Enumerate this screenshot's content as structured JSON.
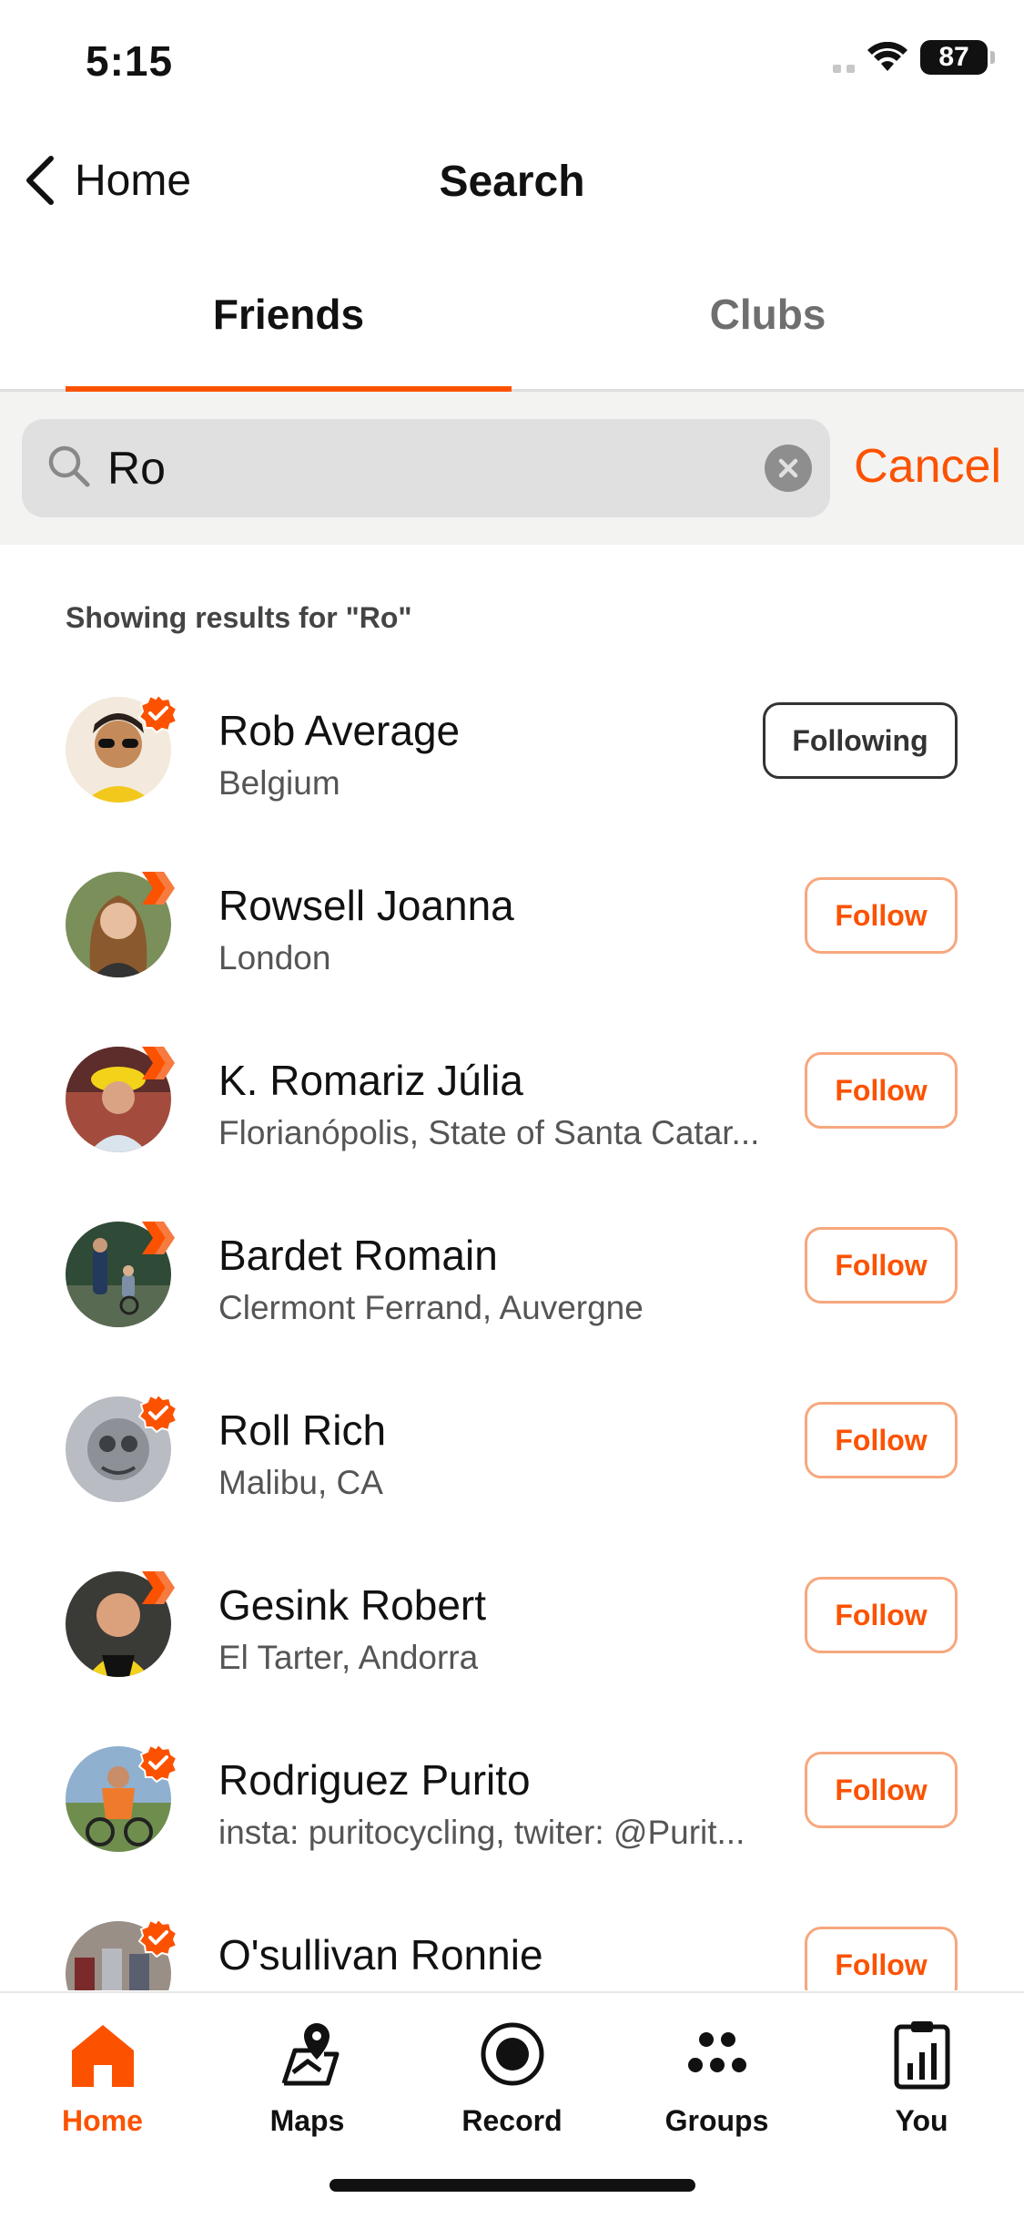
{
  "status_bar": {
    "time": "5:15",
    "battery": "87"
  },
  "nav": {
    "back_label": "Home",
    "title": "Search"
  },
  "tabs": [
    {
      "label": "Friends",
      "active": true
    },
    {
      "label": "Clubs",
      "active": false
    }
  ],
  "search": {
    "value": "Ro",
    "placeholder": "",
    "cancel_label": "Cancel"
  },
  "results_label": "Showing results for \"Ro\"",
  "results": [
    {
      "name": "Rob Average",
      "location": "Belgium",
      "button": "Following",
      "badge": "verified-badge-icon"
    },
    {
      "name": "Rowsell Joanna",
      "location": "London",
      "button": "Follow",
      "badge": "subscriber-chevron-icon"
    },
    {
      "name": "K. Romariz Júlia",
      "location": "Florianópolis, State of Santa Catar...",
      "button": "Follow",
      "badge": "subscriber-chevron-icon"
    },
    {
      "name": "Bardet Romain",
      "location": "Clermont Ferrand, Auvergne",
      "button": "Follow",
      "badge": "subscriber-chevron-icon"
    },
    {
      "name": "Roll Rich",
      "location": "Malibu, CA",
      "button": "Follow",
      "badge": "verified-badge-icon"
    },
    {
      "name": "Gesink Robert",
      "location": "El Tarter, Andorra",
      "button": "Follow",
      "badge": "subscriber-chevron-icon"
    },
    {
      "name": "Rodriguez Purito",
      "location": "insta: puritocycling, twiter: @Purit...",
      "button": "Follow",
      "badge": "verified-badge-icon"
    },
    {
      "name": "O'sullivan Ronnie",
      "location": "",
      "button": "Follow",
      "badge": "verified-badge-icon"
    }
  ],
  "tabbar": [
    {
      "label": "Home",
      "icon": "home-icon",
      "active": true
    },
    {
      "label": "Maps",
      "icon": "maps-icon",
      "active": false
    },
    {
      "label": "Record",
      "icon": "record-icon",
      "active": false
    },
    {
      "label": "Groups",
      "icon": "groups-icon",
      "active": false
    },
    {
      "label": "You",
      "icon": "you-icon",
      "active": false
    }
  ],
  "colors": {
    "accent": "#fc5200",
    "follow_border": "#f7a77e",
    "search_bg": "#e0e0e0"
  }
}
